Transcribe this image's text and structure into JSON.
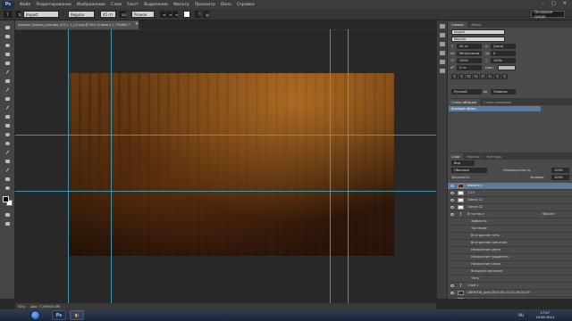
{
  "menu": {
    "logo": "Ps",
    "items": [
      "Файл",
      "Редактирование",
      "Изображение",
      "Слои",
      "Текст",
      "Выделение",
      "Фильтр",
      "Просмотр",
      "Окно",
      "Справка"
    ]
  },
  "window_controls": {
    "minimize": "–",
    "maximize": "□",
    "close": "✕"
  },
  "options_bar": {
    "font_family": "Impact",
    "font_style": "Regular",
    "font_size": "45 пт",
    "anti_alias": "Резкое",
    "workspace": "Основная среда"
  },
  "document": {
    "tab_title": "shablon_shapka_youtube_2011_1_(2).jpg @ 50% (Intikam_1, RGB/8) *",
    "close": "×",
    "zoom": "50%",
    "doc_size": "Док: 7,29М/35,6М"
  },
  "character_panel": {
    "tabs": [
      "Символ",
      "Абзац"
    ],
    "font_family": "Impact",
    "font_style": "Regular",
    "font_size": "45 пт",
    "leading": "(Авто)",
    "kerning": "Метрически",
    "tracking": "0",
    "vertical_scale": "100%",
    "horizontal_scale": "100%",
    "baseline_shift": "0 пт",
    "color_label": "Цвет:",
    "format_buttons": [
      "T",
      "T",
      "TT",
      "Tt",
      "T¹",
      "T₁",
      "T",
      "T"
    ],
    "language": "Русский",
    "anti_alias": "Плавное",
    "anti_alias_prefix": "aa"
  },
  "paragraph_styles_panel": {
    "tabs": [
      "Стили абзацев",
      "Стили символов"
    ],
    "items": [
      "Базовый абзац"
    ]
  },
  "layers_panel": {
    "tabs": [
      "Слои",
      "Каналы",
      "Контуры"
    ],
    "filter_kind": "Вид",
    "blend_mode": "Обычные",
    "opacity_label": "Непрозрачность:",
    "opacity_value": "100%",
    "lock_label": "Закрепить:",
    "fill_label": "Заливка:",
    "fill_value": "100%",
    "fx_label": "fx",
    "layers": [
      {
        "name": "texture_s",
        "thumb": "img",
        "selected": true
      },
      {
        "name": "1-10",
        "thumb": "white",
        "selected": false
      },
      {
        "name": "Линия 12",
        "thumb": "white",
        "selected": false
      },
      {
        "name": "Линия 12",
        "thumb": "white",
        "selected": false
      },
      {
        "name": "В гостях у",
        "thumb": "txt",
        "selected": false,
        "fx": "Фиолет"
      },
      {
        "name": "Эффекты",
        "thumb": "",
        "selected": false,
        "indent": true
      },
      {
        "name": "Тиснение",
        "thumb": "",
        "selected": false,
        "indent": true
      },
      {
        "name": "Внутреннее тень",
        "thumb": "",
        "selected": false,
        "indent": true
      },
      {
        "name": "Внутреннее свечение",
        "thumb": "",
        "selected": false,
        "indent": true
      },
      {
        "name": "Наложение цвета",
        "thumb": "",
        "selected": false,
        "indent": true
      },
      {
        "name": "Наложение градиента",
        "thumb": "",
        "selected": false,
        "indent": true
      },
      {
        "name": "Наложение узора",
        "thumb": "",
        "selected": false,
        "indent": true
      },
      {
        "name": "Внешнее свечение",
        "thumb": "",
        "selected": false,
        "indent": true
      },
      {
        "name": "Тень",
        "thumb": "",
        "selected": false,
        "indent": true
      },
      {
        "name": "Слой 1",
        "thumb": "txt",
        "selected": false
      },
      {
        "name": "LBENYOB_jpeg 2013-05-24 22-16-02-19",
        "thumb": "img",
        "selected": false
      },
      {
        "name": "Слой 1",
        "thumb": "stripe",
        "selected": false
      },
      {
        "name": "Фон",
        "thumb": "white",
        "selected": false
      }
    ]
  },
  "taskbar": {
    "apps": [
      "Ps",
      "◐"
    ],
    "language": "RU",
    "time": "17:47",
    "date": "19.06.2014"
  },
  "colors": {
    "guide": "#3fa8c8",
    "panel_bg": "#4a4a4a",
    "selection": "#5a7aa0",
    "image_warm": "#6a3a12",
    "image_dark": "#2b160b"
  }
}
